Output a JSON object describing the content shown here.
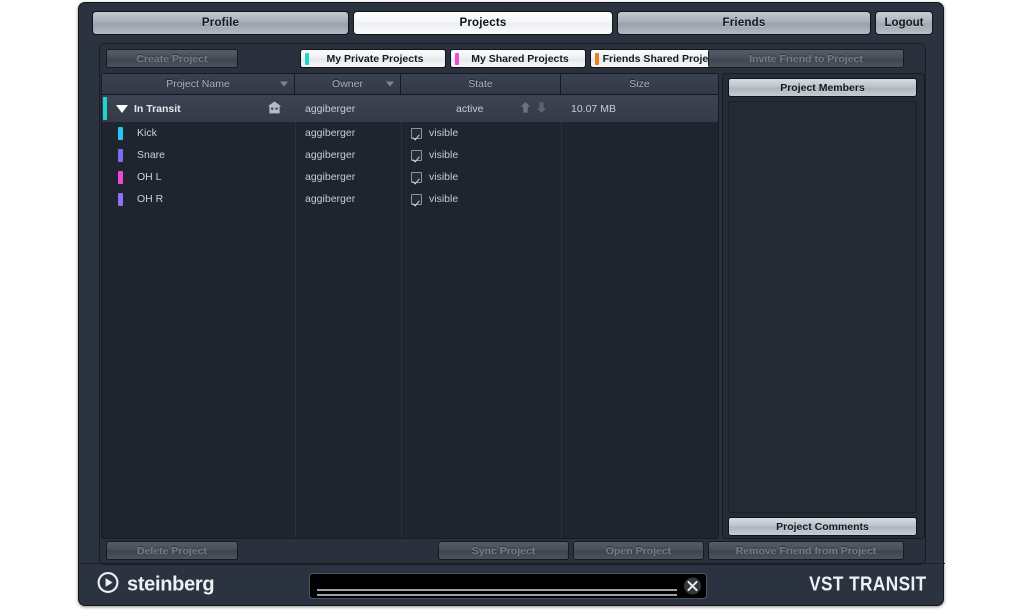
{
  "app": {
    "title": "VST Transit",
    "brand": "steinberg",
    "product_logo": "VST TRANSIT"
  },
  "top_tabs": [
    {
      "id": "profile",
      "label": "Profile",
      "active": false
    },
    {
      "id": "projects",
      "label": "Projects",
      "active": true
    },
    {
      "id": "friends",
      "label": "Friends",
      "active": false
    }
  ],
  "logout": {
    "label": "Logout"
  },
  "toolbar": {
    "create_project": "Create Project",
    "invite_friend": "Invite Friend to Project",
    "project_tabs": [
      {
        "label": "My Private Projects",
        "color": "#1fd6cd"
      },
      {
        "label": "My Shared Projects",
        "color": "#ef4bd2"
      },
      {
        "label": "Friends Shared Projects",
        "color": "#e8821e"
      }
    ]
  },
  "table": {
    "columns": [
      {
        "key": "name",
        "label": "Project Name",
        "sortable": true
      },
      {
        "key": "owner",
        "label": "Owner",
        "sortable": true
      },
      {
        "key": "state",
        "label": "State",
        "sortable": false
      },
      {
        "key": "size",
        "label": "Size",
        "sortable": false
      }
    ],
    "project": {
      "name": "In Transit",
      "owner": "aggiberger",
      "state": "active",
      "size": "10.07 MB",
      "selected": true,
      "expanded": true,
      "marker_color": "#1fd6cd",
      "home_icon": "house-icon",
      "upload_icon": "upload-arrow-icon",
      "download_icon": "download-arrow-icon"
    },
    "tracks": [
      {
        "name": "Kick",
        "owner": "aggiberger",
        "state": "visible",
        "checked": true,
        "color": "#29c5f0",
        "size": ""
      },
      {
        "name": "Snare",
        "owner": "aggiberger",
        "state": "visible",
        "checked": true,
        "color": "#7b6cf0",
        "size": ""
      },
      {
        "name": "OH L",
        "owner": "aggiberger",
        "state": "visible",
        "checked": true,
        "color": "#e84cd6",
        "size": ""
      },
      {
        "name": "OH R",
        "owner": "aggiberger",
        "state": "visible",
        "checked": true,
        "color": "#8a72f2",
        "size": ""
      }
    ]
  },
  "side_panel": {
    "members_header": "Project Members",
    "comments_header": "Project Comments",
    "members": []
  },
  "footer_buttons": {
    "delete_project": "Delete Project",
    "sync_project": "Sync Project",
    "open_project": "Open Project",
    "remove_friend": "Remove Friend from Project"
  },
  "status_bar": {
    "value": "",
    "placeholder": "",
    "close_icon": "close-icon",
    "progress_primary": 0,
    "progress_secondary": 0
  },
  "colors": {
    "accent_teal": "#1fd6cd",
    "accent_magenta": "#ef4bd2",
    "accent_orange": "#e8821e",
    "panel_bg": "#2a303c",
    "window_bg": "#2c3340",
    "table_bg": "#1f242e"
  }
}
